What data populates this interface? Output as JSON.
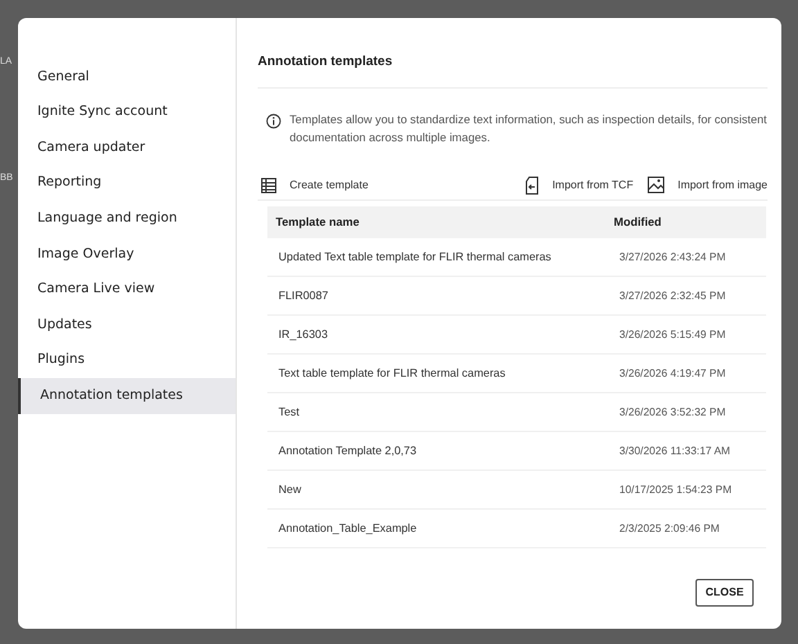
{
  "backdrop_texts": [
    "LA",
    "BB"
  ],
  "sidebar": {
    "items": [
      {
        "label": "General",
        "selected": false
      },
      {
        "label": "Ignite Sync account",
        "selected": false
      },
      {
        "label": "Camera updater",
        "selected": false
      },
      {
        "label": "Reporting",
        "selected": false
      },
      {
        "label": "Language and region",
        "selected": false
      },
      {
        "label": "Image Overlay",
        "selected": false
      },
      {
        "label": "Camera Live view",
        "selected": false
      },
      {
        "label": "Updates",
        "selected": false
      },
      {
        "label": "Plugins",
        "selected": false
      },
      {
        "label": "Annotation templates",
        "selected": true
      }
    ]
  },
  "content": {
    "title": "Annotation templates",
    "info": "Templates allow you to standardize text information, such as inspection details, for consistent documentation across multiple images.",
    "toolbar": [
      {
        "kind": "create",
        "label": "Create template"
      },
      {
        "kind": "tcf",
        "label": "Import from TCF"
      },
      {
        "kind": "image",
        "label": "Import from image"
      }
    ],
    "table": {
      "columns": [
        "Template name",
        "Modified"
      ],
      "rows": [
        [
          "Updated Text table template for FLIR thermal cameras",
          "3/27/2026 2:43:24 PM"
        ],
        [
          "FLIR0087",
          "3/27/2026 2:32:45 PM"
        ],
        [
          "IR_16303",
          "3/26/2026 5:15:49 PM"
        ],
        [
          "Text table template for FLIR thermal cameras",
          "3/26/2026 4:19:47 PM"
        ],
        [
          "Test",
          "3/26/2026 3:52:32 PM"
        ],
        [
          "Annotation Template 2,0,73",
          "3/30/2026 11:33:17 AM"
        ],
        [
          "New",
          "10/17/2025 1:54:23 PM"
        ],
        [
          "Annotation_Table_Example",
          "2/3/2025 2:09:46 PM"
        ]
      ]
    }
  },
  "buttons": [
    "CLOSE"
  ]
}
